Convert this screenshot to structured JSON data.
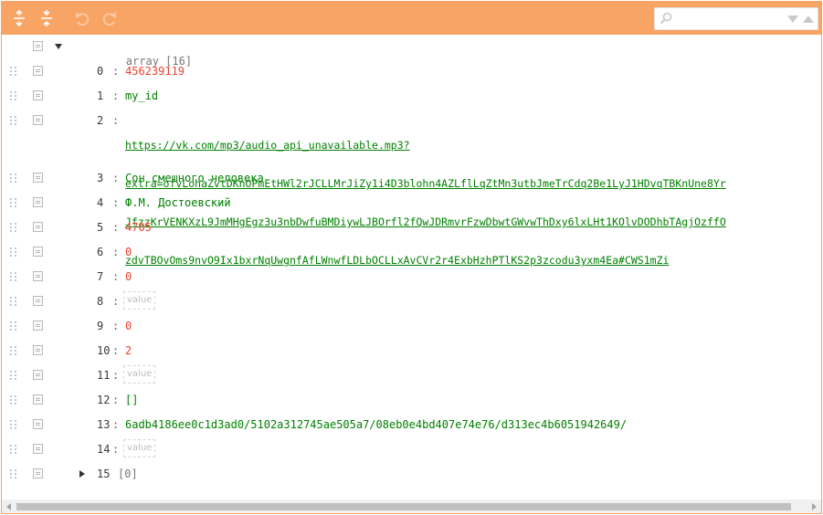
{
  "colors": {
    "accent": "#f7a464",
    "number": "#ee422e",
    "string": "#008000"
  },
  "toolbar": {
    "buttons": [
      "expand-all-icon",
      "collapse-all-icon",
      "undo-icon",
      "redo-icon"
    ],
    "search": {
      "value": "",
      "placeholder": ""
    }
  },
  "root": {
    "label": "array",
    "count": "[16]"
  },
  "rows": [
    {
      "index": "0",
      "value": "456239119",
      "kind": "number"
    },
    {
      "index": "1",
      "value": "my_id",
      "kind": "string"
    },
    {
      "index": "2",
      "value_lines": [
        "https://vk.com/mp3/audio_api_unavailable.mp3?",
        "extra=ofvLohaZvtDKnOPmEtHWl2rJCLLMrJiZy1i4D3blohn4AZLflLqZtMn3utbJmeTrCdq2Be1LyJ1HDvqTBKnUne8Yr",
        "JfzzKrVENKXzL9JmMHgEgz3u3nbDwfuBMDiywLJBOrfl2fQwJDRmvrFzwDbwtGWvwThDxy6lxLHt1KOlvDODhbTAgjOzffO",
        "zdvTBOvOms9nvO9Ix1bxrNqUwgnfAfLWnwfLDLbOCLLxAvCVr2r4ExbHzhPTlKS2p3zcodu3yxm4Ea#CWS1mZi"
      ],
      "kind": "link"
    },
    {
      "index": "3",
      "value": "Сон смешного человека",
      "kind": "string"
    },
    {
      "index": "4",
      "value": "Ф.М. Достоевский",
      "kind": "string"
    },
    {
      "index": "5",
      "value": "4705",
      "kind": "number"
    },
    {
      "index": "6",
      "value": "0",
      "kind": "number"
    },
    {
      "index": "7",
      "value": "0",
      "kind": "number"
    },
    {
      "index": "8",
      "value": "value",
      "kind": "empty"
    },
    {
      "index": "9",
      "value": "0",
      "kind": "number"
    },
    {
      "index": "10",
      "value": "2",
      "kind": "number"
    },
    {
      "index": "11",
      "value": "value",
      "kind": "empty"
    },
    {
      "index": "12",
      "value": "[]",
      "kind": "array"
    },
    {
      "index": "13",
      "value": "6adb4186ee0c1d3ad0/5102a312745ae505a7/08eb0e4bd407e74e76/d313ec4b6051942649/",
      "kind": "string"
    },
    {
      "index": "14",
      "value": "value",
      "kind": "empty"
    }
  ],
  "last": {
    "index": "15",
    "count": "[0]"
  }
}
